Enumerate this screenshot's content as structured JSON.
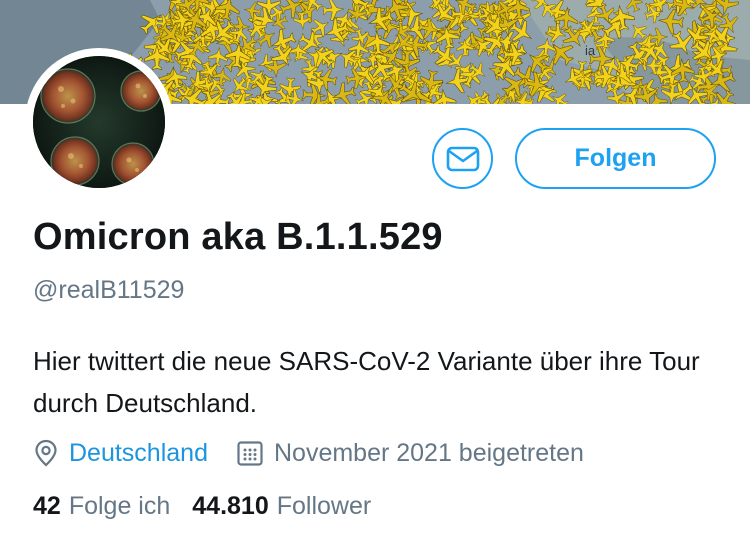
{
  "banner": {
    "label": "ia"
  },
  "profile": {
    "name": "Omicron aka B.1.1.529",
    "handle": "@realB11529",
    "bio": "Hier twittert die neue SARS-CoV-2 Variante über ihre Tour durch Deutschland.",
    "location": "Deutschland",
    "joined": "November 2021 beigetreten"
  },
  "actions": {
    "follow_label": "Folgen",
    "message_icon": "envelope-icon"
  },
  "stats": {
    "following_count": "42",
    "following_label": "Folge ich",
    "followers_count": "44.810",
    "followers_label": "Follower"
  },
  "colors": {
    "accent": "#1da1f2",
    "link": "#1b95e0",
    "text": "#14171a",
    "secondary": "#657786",
    "plane": "#f2d21b"
  }
}
